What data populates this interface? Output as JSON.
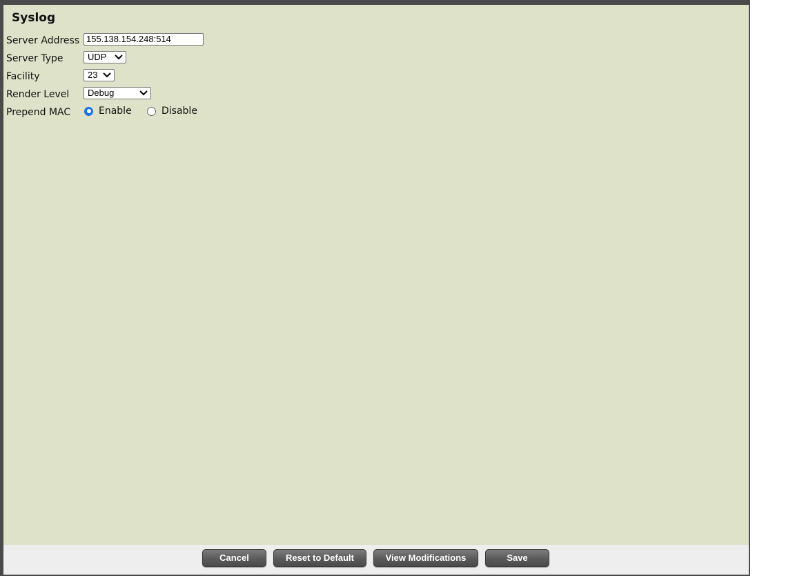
{
  "page": {
    "title": "Syslog"
  },
  "form": {
    "server_address": {
      "label": "Server Address",
      "value": "155.138.154.248:514"
    },
    "server_type": {
      "label": "Server Type",
      "selected": "UDP"
    },
    "facility": {
      "label": "Facility",
      "selected": "23"
    },
    "render_level": {
      "label": "Render Level",
      "selected": "Debug"
    },
    "prepend_mac": {
      "label": "Prepend MAC",
      "options": [
        "Enable",
        "Disable"
      ],
      "selected": "Enable"
    }
  },
  "footer": {
    "cancel_label": "Cancel",
    "reset_label": "Reset to Default",
    "view_modifications_label": "View Modifications",
    "save_label": "Save"
  },
  "colors": {
    "panel_background": "#dde2c8",
    "footer_background": "#eeeeee",
    "frame": "#4a4a4a",
    "radio_accent": "#1a73e8"
  }
}
